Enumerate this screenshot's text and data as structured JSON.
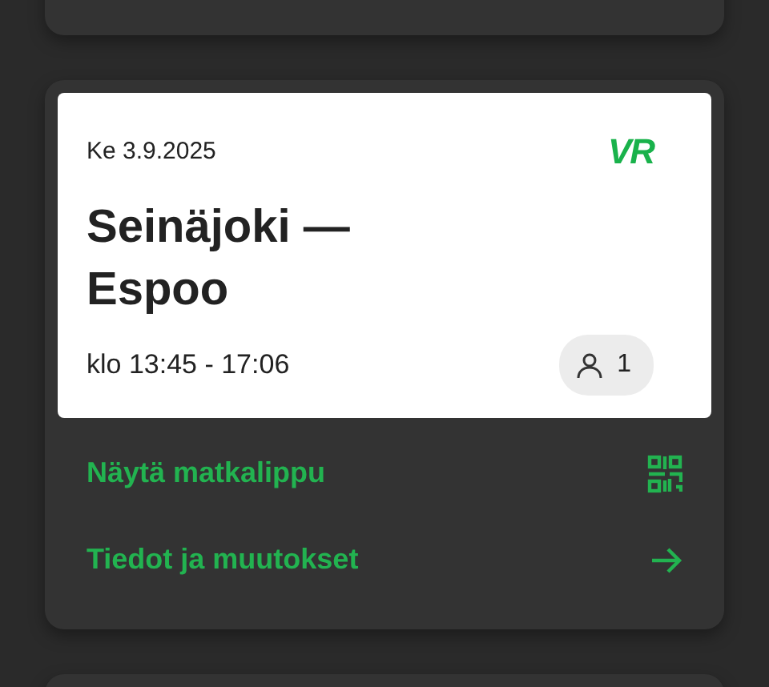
{
  "ticket": {
    "date": "Ke 3.9.2025",
    "logo": "VR",
    "route": "Seinäjoki — Espoo",
    "time": "klo 13:45 - 17:06",
    "passengers": "1"
  },
  "actions": [
    {
      "kind": "qr",
      "label": "Näytä matkalippu"
    },
    {
      "kind": "arrow",
      "label": "Tiedot ja muutokset"
    }
  ]
}
